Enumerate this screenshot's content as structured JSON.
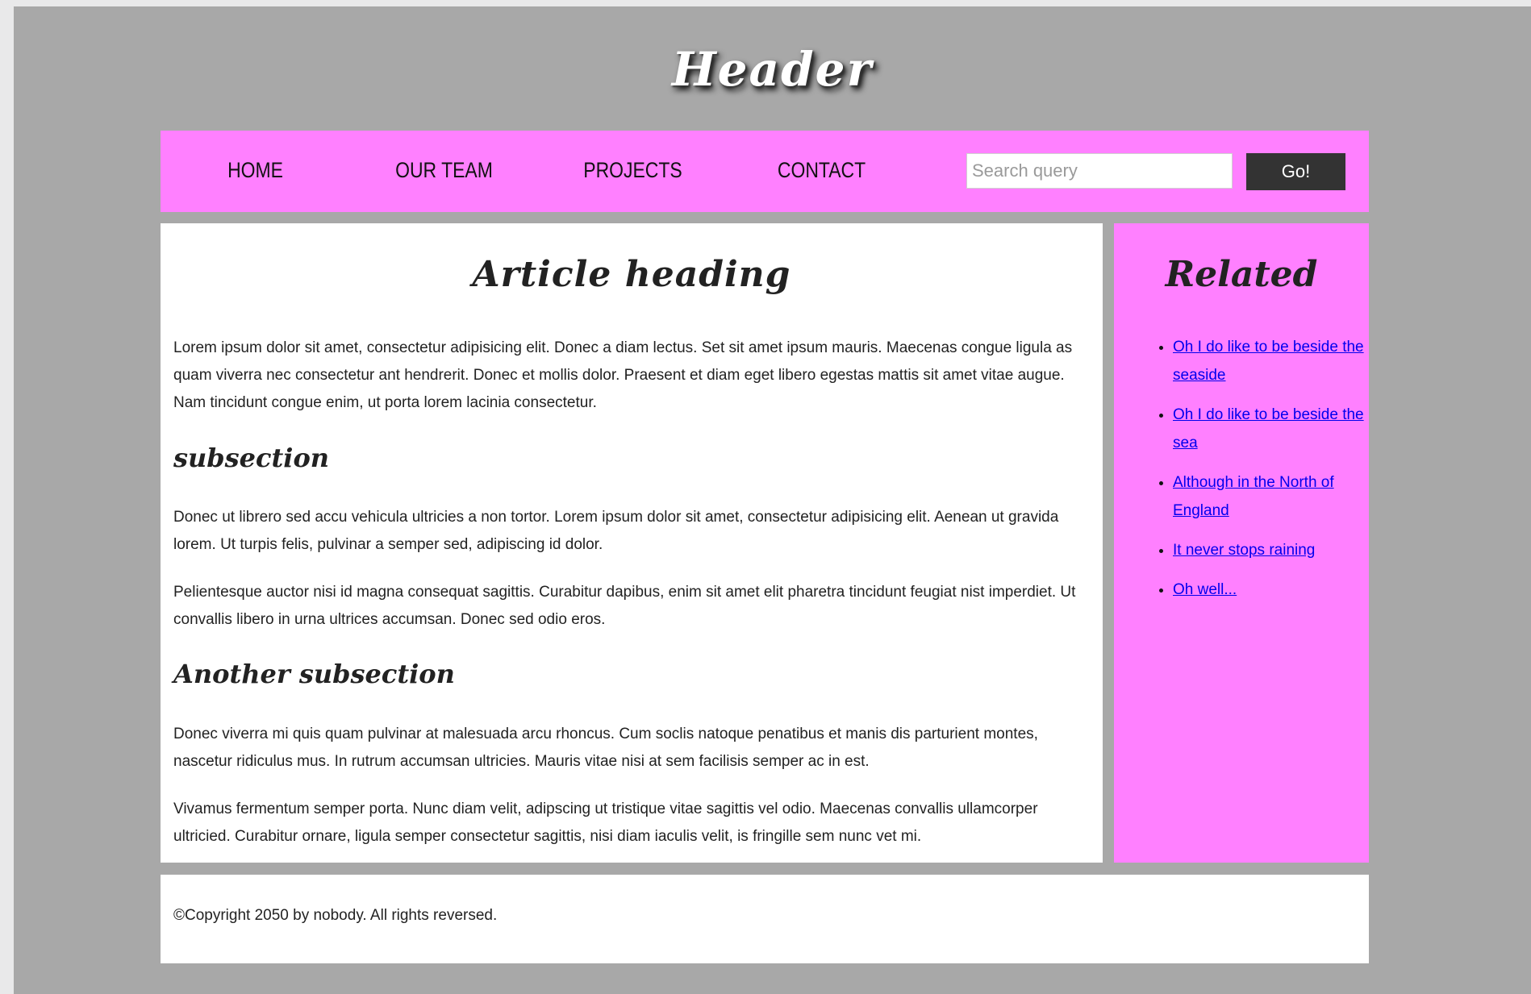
{
  "header": {
    "title": "Header"
  },
  "nav": {
    "items": [
      {
        "label": "HOME"
      },
      {
        "label": "OUR TEAM"
      },
      {
        "label": "PROJECTS"
      },
      {
        "label": "CONTACT"
      }
    ],
    "search": {
      "placeholder": "Search query",
      "value": "",
      "button_label": "Go!"
    }
  },
  "article": {
    "heading": "Article heading",
    "intro": "Lorem ipsum dolor sit amet, consectetur adipisicing elit. Donec a diam lectus. Set sit amet ipsum mauris. Maecenas congue ligula as quam viverra nec consectetur ant hendrerit. Donec et mollis dolor. Praesent et diam eget libero egestas mattis sit amet vitae augue. Nam tincidunt congue enim, ut porta lorem lacinia consectetur.",
    "sections": [
      {
        "heading": "subsection",
        "paragraphs": [
          "Donec ut librero sed accu vehicula ultricies a non tortor. Lorem ipsum dolor sit amet, consectetur adipisicing elit. Aenean ut gravida lorem. Ut turpis felis, pulvinar a semper sed, adipiscing id dolor.",
          "Pelientesque auctor nisi id magna consequat sagittis. Curabitur dapibus, enim sit amet elit pharetra tincidunt feugiat nist imperdiet. Ut convallis libero in urna ultrices accumsan. Donec sed odio eros."
        ]
      },
      {
        "heading": "Another subsection",
        "paragraphs": [
          "Donec viverra mi quis quam pulvinar at malesuada arcu rhoncus. Cum soclis natoque penatibus et manis dis parturient montes, nascetur ridiculus mus. In rutrum accumsan ultricies. Mauris vitae nisi at sem facilisis semper ac in est.",
          "Vivamus fermentum semper porta. Nunc diam velit, adipscing ut tristique vitae sagittis vel odio. Maecenas convallis ullamcorper ultricied. Curabitur ornare, ligula semper consectetur sagittis, nisi diam iaculis velit, is fringille sem nunc vet mi."
        ]
      }
    ]
  },
  "sidebar": {
    "heading": "Related",
    "links": [
      {
        "label": "Oh I do like to be beside the seaside"
      },
      {
        "label": "Oh I do like to be beside the sea"
      },
      {
        "label": "Although in the North of England"
      },
      {
        "label": "It never stops raining"
      },
      {
        "label": "Oh well..."
      }
    ]
  },
  "footer": {
    "text": "©Copyright 2050 by nobody. All rights reversed."
  },
  "colors": {
    "page_background": "#a8a8a8",
    "nav_background": "#ff80ff",
    "sidebar_background": "#ff80ff",
    "button_background": "#333333",
    "link_color": "#0000ee"
  }
}
